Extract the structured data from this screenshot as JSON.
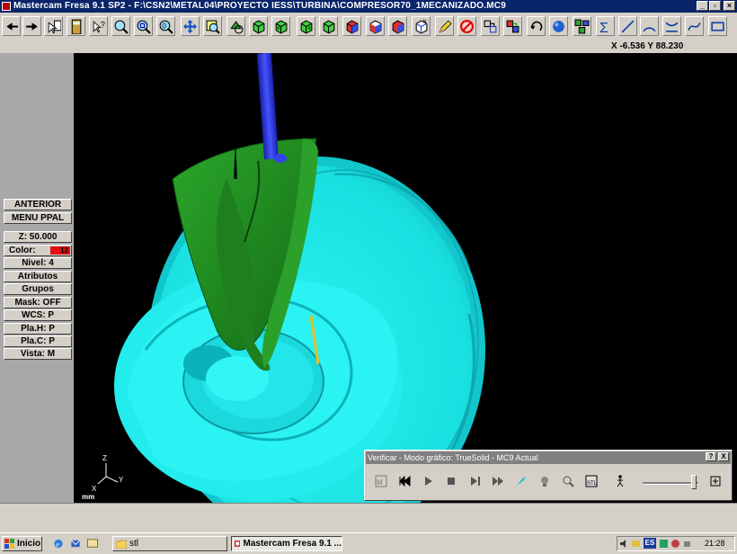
{
  "window": {
    "title": "Mastercam Fresa 9.1 SP2 - F:\\CSN2\\METAL04\\PROYECTO IESS\\TURBINA\\COMPRESOR70_1MECANIZADO.MC9",
    "controls": [
      "minimize",
      "restore",
      "close"
    ]
  },
  "toolbar": {
    "icons": [
      "arrow-left-icon",
      "arrow-right-icon",
      "pointer-menu-icon",
      "calculator-icon",
      "help-pointer-icon",
      "zoom-icon",
      "zoom-window-icon",
      "zoom-out-icon",
      "pan-icon",
      "zoom-fit-icon",
      "repaint-icon",
      "view-top-cube-icon",
      "view-front-cube-icon",
      "view-side-cube-icon",
      "view-iso-cube-icon",
      "cube-red-icon",
      "cube-face-icon",
      "cube-red-2-icon",
      "cube-wire-icon",
      "pencil-icon",
      "no-entry-icon",
      "transform-icon",
      "transform-color-icon",
      "undo-icon",
      "sphere-icon",
      "blocks-icon",
      "sum-icon",
      "line-icon",
      "arc-icon",
      "trim-icon",
      "spline-icon",
      "rectangle-icon"
    ]
  },
  "coords": {
    "text": "X -6.536  Y 88.230"
  },
  "menu": {
    "anterior": "ANTERIOR",
    "menu_ppal": "MENU PPAL"
  },
  "status_panel": {
    "z": "Z:  50.000",
    "color_label": "Color:",
    "color_value": "12",
    "nivel": "Nivel:  4",
    "atributos": "Atributos",
    "grupos": "Grupos",
    "mask": "Mask:  OFF",
    "wcs": "WCS:   P",
    "plah": "Pla.H:  P",
    "plac": "Pla.C:  P",
    "vista": "Vista:   M"
  },
  "triad": {
    "z": "Z",
    "x": "X",
    "y": "Y",
    "units": "mm"
  },
  "verify_dialog": {
    "title": "Verificar - Modo gráfico: TrueSolid  - MC9 Actual",
    "help": "?",
    "close": "X",
    "slider_level": 0.92
  },
  "taskbar": {
    "start": "Inicio",
    "tasks": [
      {
        "label": "stl",
        "active": false
      },
      {
        "label": "Mastercam Fresa 9.1 ...",
        "active": true
      }
    ],
    "tray": {
      "lang": "ES",
      "clock": "21:28"
    }
  },
  "colors": {
    "viewport_bg": "#000000",
    "part_cyan": "#19e6e6",
    "blade_green": "#1e8c1e",
    "tool_blue": "#2233dd",
    "title_blue": "#0a246a",
    "color_swatch": "#e01010"
  }
}
